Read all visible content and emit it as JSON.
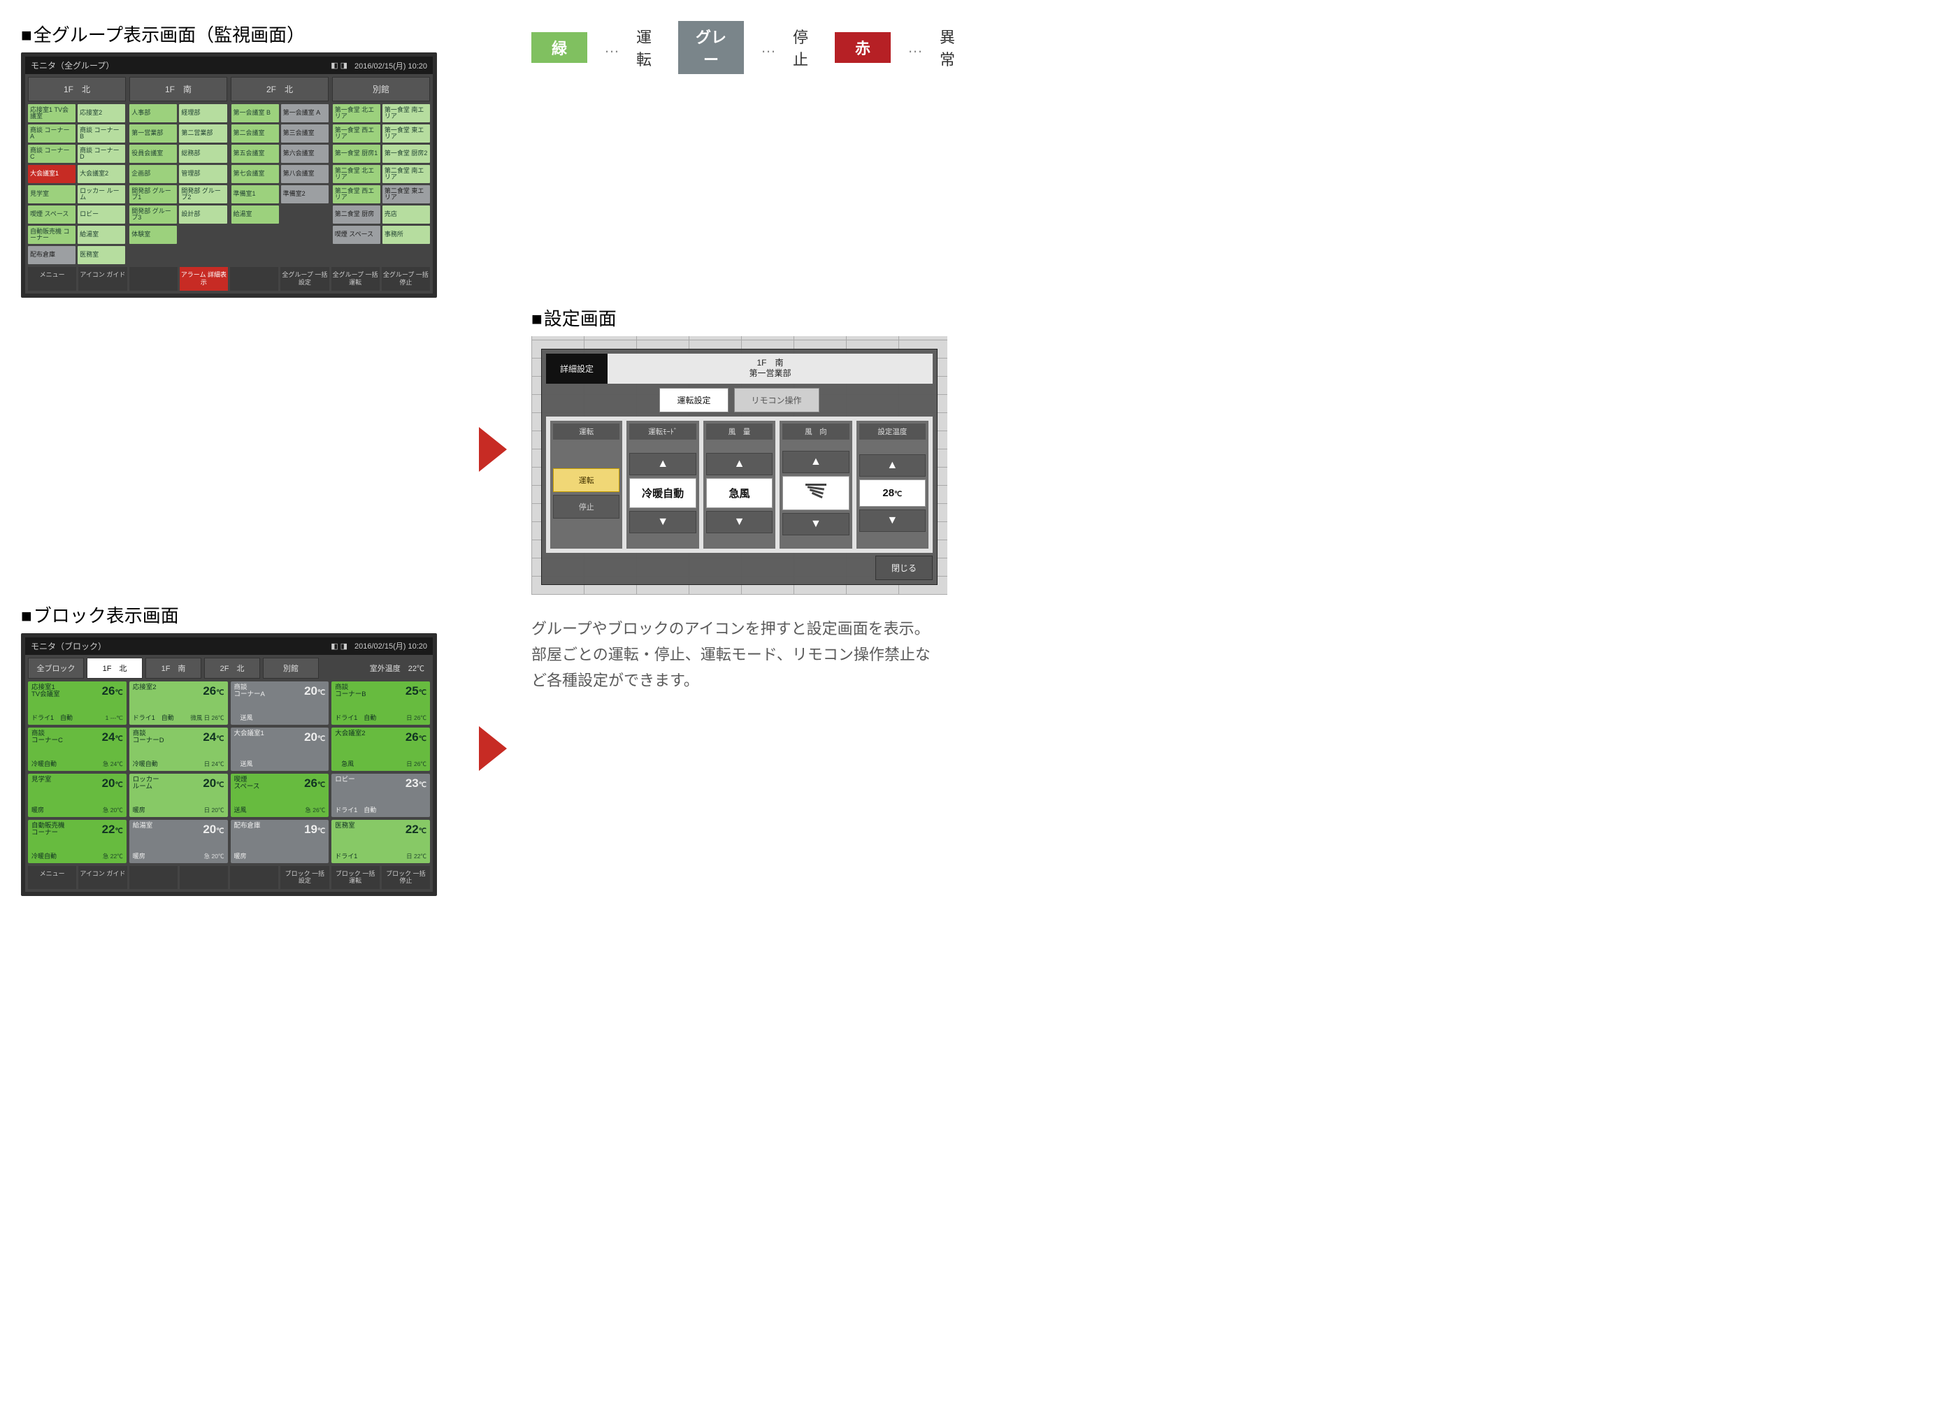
{
  "legend": {
    "green": {
      "chip": "緑",
      "label": "運転"
    },
    "gray": {
      "chip": "グレー",
      "label": "停止"
    },
    "red": {
      "chip": "赤",
      "label": "異常"
    },
    "sep": "…"
  },
  "titles": {
    "all_group": "全グループ表示画面（監視画面）",
    "block": "ブロック表示画面",
    "settings": "設定画面"
  },
  "description": "グループやブロックのアイコンを押すと設定画面を表示。部屋ごとの運転・停止、運転モード、リモコン操作禁止など各種設定ができます。",
  "panel_header": {
    "title_groups": "モニタ（全グループ）",
    "title_block": "モニタ（ブロック）",
    "datetime": "2016/02/15(月) 10:20"
  },
  "all_group": {
    "zone_tabs": [
      "1F　北",
      "1F　南",
      "2F　北",
      "別館"
    ],
    "zones": {
      "z1": [
        {
          "t": "応接室1\nTV会議室",
          "c": "g"
        },
        {
          "t": "応接室2",
          "c": "gh"
        },
        {
          "t": "商談\nコーナーA",
          "c": "g"
        },
        {
          "t": "商談\nコーナーB",
          "c": "gh"
        },
        {
          "t": "商談\nコーナーC",
          "c": "g"
        },
        {
          "t": "商談\nコーナーD",
          "c": "gh"
        },
        {
          "t": "大会議室1",
          "c": "r"
        },
        {
          "t": "大会議室2",
          "c": "gh"
        },
        {
          "t": "見学室",
          "c": "g"
        },
        {
          "t": "ロッカー\nルーム",
          "c": "gh"
        },
        {
          "t": "喫煙\nスペース",
          "c": "g"
        },
        {
          "t": "ロビー",
          "c": "gh"
        },
        {
          "t": "自動販売機\nコーナー",
          "c": "g"
        },
        {
          "t": "給湯室",
          "c": "gh"
        },
        {
          "t": "配布倉庫",
          "c": "gr"
        },
        {
          "t": "医務室",
          "c": "gh"
        }
      ],
      "z2": [
        {
          "t": "人事部",
          "c": "g"
        },
        {
          "t": "経理部",
          "c": "gh"
        },
        {
          "t": "第一営業部",
          "c": "g"
        },
        {
          "t": "第二営業部",
          "c": "gh"
        },
        {
          "t": "役員会議室",
          "c": "g"
        },
        {
          "t": "総務部",
          "c": "gh"
        },
        {
          "t": "企画部",
          "c": "g"
        },
        {
          "t": "管理部",
          "c": "gh"
        },
        {
          "t": "開発部\nグループ1",
          "c": "g"
        },
        {
          "t": "開発部\nグループ2",
          "c": "gh"
        },
        {
          "t": "開発部\nグループ3",
          "c": "g"
        },
        {
          "t": "設計部",
          "c": "gh"
        },
        {
          "t": "体験室",
          "c": "g"
        },
        {
          "t": "",
          "c": "empty"
        }
      ],
      "z3": [
        {
          "t": "第一会議室\nB",
          "c": "g"
        },
        {
          "t": "第一会議室\nA",
          "c": "gr"
        },
        {
          "t": "第二会議室",
          "c": "g"
        },
        {
          "t": "第三会議室",
          "c": "gr"
        },
        {
          "t": "第五会議室",
          "c": "g"
        },
        {
          "t": "第六会議室",
          "c": "gr"
        },
        {
          "t": "第七会議室",
          "c": "g"
        },
        {
          "t": "第八会議室",
          "c": "gr"
        },
        {
          "t": "準備室1",
          "c": "g"
        },
        {
          "t": "準備室2",
          "c": "gr"
        },
        {
          "t": "給湯室",
          "c": "g"
        },
        {
          "t": "",
          "c": "empty"
        }
      ],
      "z4": [
        {
          "t": "第一食堂\n北エリア",
          "c": "g"
        },
        {
          "t": "第一食堂\n南エリア",
          "c": "gh"
        },
        {
          "t": "第一食堂\n西エリア",
          "c": "g"
        },
        {
          "t": "第一食堂\n東エリア",
          "c": "gh"
        },
        {
          "t": "第一食堂\n厨房1",
          "c": "g"
        },
        {
          "t": "第一食堂\n厨房2",
          "c": "gh"
        },
        {
          "t": "第二食堂\n北エリア",
          "c": "g"
        },
        {
          "t": "第二食堂\n南エリア",
          "c": "gh"
        },
        {
          "t": "第二食堂\n西エリア",
          "c": "g"
        },
        {
          "t": "第二食堂\n東エリア",
          "c": "gr"
        },
        {
          "t": "第二食堂\n厨房",
          "c": "gr"
        },
        {
          "t": "売店",
          "c": "gh"
        },
        {
          "t": "喫煙\nスペース",
          "c": "gr"
        },
        {
          "t": "事務所",
          "c": "gh"
        }
      ]
    },
    "footer": [
      "メニュー",
      "アイコン\nガイド",
      "",
      "アラーム\n詳細表示",
      "",
      "全グループ\n一括設定",
      "全グループ\n一括運転",
      "全グループ\n一括停止"
    ]
  },
  "block": {
    "tabs": [
      "全ブロック",
      "1F　北",
      "1F　南",
      "2F　北",
      "別館"
    ],
    "outdoor_label": "室外温度",
    "outdoor_value": "22℃",
    "cards": [
      {
        "name": "応接室1\nTV会議室",
        "temp": "26",
        "c": "g",
        "mode": "ドライ1",
        "sub": "自動",
        "fan": "1 ---℃"
      },
      {
        "name": "応接室2",
        "temp": "26",
        "c": "gh",
        "mode": "ドライ1",
        "sub": "自動",
        "fan": "微風\n日 26℃"
      },
      {
        "name": "商談\nコーナーA",
        "temp": "20",
        "c": "gr",
        "mode": "",
        "sub": "送風",
        "fan": ""
      },
      {
        "name": "商談\nコーナーB",
        "temp": "25",
        "c": "g",
        "mode": "ドライ1",
        "sub": "自動",
        "fan": "日 26℃"
      },
      {
        "name": "商談\nコーナーC",
        "temp": "24",
        "c": "g",
        "mode": "冷暖自動",
        "sub": "",
        "fan": "急 24℃"
      },
      {
        "name": "商談\nコーナーD",
        "temp": "24",
        "c": "gh",
        "mode": "冷暖自動",
        "sub": "",
        "fan": "日 24℃"
      },
      {
        "name": "大会議室1",
        "temp": "20",
        "c": "gr",
        "mode": "",
        "sub": "送風",
        "fan": ""
      },
      {
        "name": "大会議室2",
        "temp": "26",
        "c": "g",
        "mode": "",
        "sub": "急風",
        "fan": "日 26℃"
      },
      {
        "name": "見学室",
        "temp": "20",
        "c": "g",
        "mode": "暖房",
        "sub": "",
        "fan": "急 20℃"
      },
      {
        "name": "ロッカー\nルーム",
        "temp": "20",
        "c": "gh",
        "mode": "暖房",
        "sub": "",
        "fan": "日 20℃"
      },
      {
        "name": "喫煙\nスペース",
        "temp": "26",
        "c": "g",
        "mode": "送風",
        "sub": "",
        "fan": "急 26℃"
      },
      {
        "name": "ロビー",
        "temp": "23",
        "c": "gr",
        "mode": "ドライ1",
        "sub": "自動",
        "fan": ""
      },
      {
        "name": "自動販売機\nコーナー",
        "temp": "22",
        "c": "g",
        "mode": "冷暖自動",
        "sub": "",
        "fan": "急 22℃"
      },
      {
        "name": "給湯室",
        "temp": "20",
        "c": "gr",
        "mode": "暖房",
        "sub": "",
        "fan": "急 20℃"
      },
      {
        "name": "配布倉庫",
        "temp": "19",
        "c": "gr",
        "mode": "暖房",
        "sub": "",
        "fan": ""
      },
      {
        "name": "医務室",
        "temp": "22",
        "c": "gh",
        "mode": "ドライ1",
        "sub": "",
        "fan": "日 22℃"
      }
    ],
    "footer": [
      "メニュー",
      "アイコン\nガイド",
      "",
      "",
      "",
      "ブロック\n一括設定",
      "ブロック\n一括運転",
      "ブロック\n一括停止"
    ]
  },
  "settings": {
    "head_btn": "詳細設定",
    "head_title_line1": "1F　南",
    "head_title_line2": "第一営業部",
    "tabs": [
      "運転設定",
      "リモコン操作"
    ],
    "card_headers": [
      "運転",
      "運転ﾓｰﾄﾞ",
      "風　量",
      "風　向",
      "設定温度"
    ],
    "card1": {
      "on": "運転",
      "off": "停止"
    },
    "card2": {
      "val": "冷暖自動"
    },
    "card3": {
      "val": "急風"
    },
    "card4": {
      "val_icon": "⬔"
    },
    "card5": {
      "val": "28",
      "unit": "℃"
    },
    "arrow_up": "▲",
    "arrow_dn": "▼",
    "close": "閉じる"
  }
}
